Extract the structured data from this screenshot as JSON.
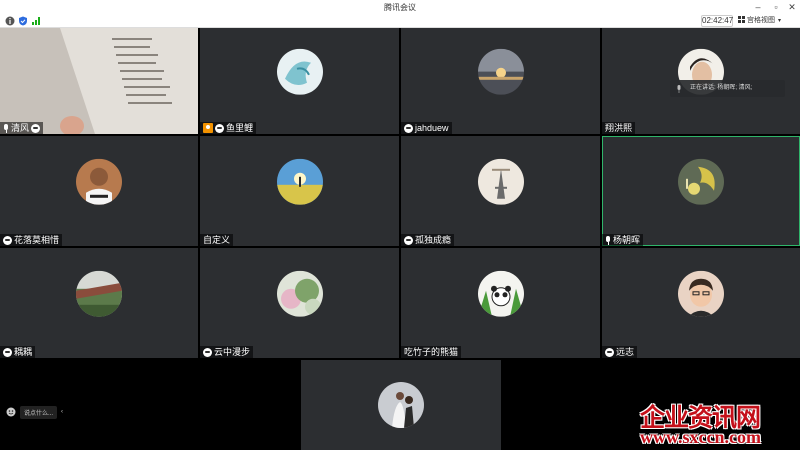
{
  "window": {
    "title": "腾讯会议"
  },
  "toolbar": {
    "timer": "02:42:47",
    "view_label": "宫格视图"
  },
  "participants": [
    {
      "name": "清风"
    },
    {
      "name": "鱼里鲤"
    },
    {
      "name": "jahduew"
    },
    {
      "name": "翔洪熙"
    },
    {
      "name": "花落莫相惜"
    },
    {
      "name": "自定义"
    },
    {
      "name": "孤独成瘾"
    },
    {
      "name": "杨朝晖"
    },
    {
      "name": "耦耦"
    },
    {
      "name": "云中漫步"
    },
    {
      "name": "吃竹子的熊猫"
    },
    {
      "name": "远志"
    }
  ],
  "speaking": {
    "label": "正在讲话: 杨朝晖; 清风;"
  },
  "bottom": {
    "say_placeholder": "说点什么..."
  },
  "watermark": {
    "title": "企业资讯网",
    "url": "www.sxccn.com"
  },
  "colors": {
    "active_border": "#2fb56a",
    "tile_bg": "#2c2e31",
    "watermark": "#c4101a"
  }
}
